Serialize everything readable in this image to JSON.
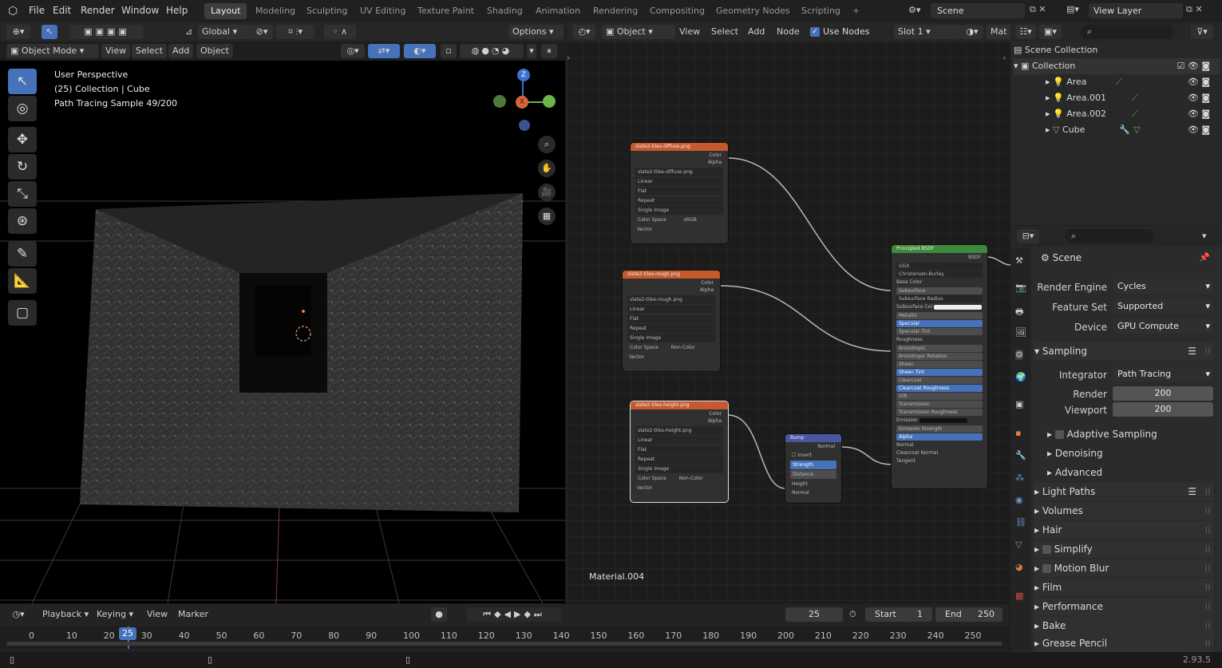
{
  "topbar": {
    "menus": [
      "File",
      "Edit",
      "Render",
      "Window",
      "Help"
    ],
    "workspaces": [
      "Layout",
      "Modeling",
      "Sculpting",
      "UV Editing",
      "Texture Paint",
      "Shading",
      "Animation",
      "Rendering",
      "Compositing",
      "Geometry Nodes",
      "Scripting"
    ],
    "active_workspace": "Layout",
    "scene": "Scene",
    "view_layer": "View Layer"
  },
  "viewport_header": {
    "transform": "Global",
    "options": "Options",
    "mode": "Object Mode",
    "menus": [
      "View",
      "Select",
      "Add",
      "Object"
    ]
  },
  "viewport_overlay": {
    "line1": "User Perspective",
    "line2": "(25) Collection | Cube",
    "line3": "Path Tracing Sample 49/200"
  },
  "gizmo": {
    "z": "Z",
    "x": "X"
  },
  "node_editor": {
    "object": "Object",
    "menus": [
      "View",
      "Select",
      "Add",
      "Node"
    ],
    "use_nodes": "Use Nodes",
    "slot": "Slot 1",
    "mat_partial": "Mat",
    "material_label": "Material.004",
    "nodes": {
      "img1_title": "slate2-tiles-diffuse.png",
      "img2_title": "slate2-tiles-rough.png",
      "img3_title": "slate2-tiles-height.png",
      "bump_title": "Bump",
      "bsdf_title": "Principled BSDF",
      "color": "Color",
      "alpha": "Alpha",
      "linear": "Linear",
      "flat": "Flat",
      "repeat": "Repeat",
      "single_image": "Single Image",
      "color_space": "Color Space",
      "srgb": "sRGB",
      "non_color": "Non-Color",
      "vector": "Vector",
      "bsdf_out": "BSDF",
      "ggx": "GGX",
      "christensen": "Christensen-Burley",
      "base_color": "Base Color",
      "subsurface": "Subsurface",
      "subsurface_radius": "Subsurface Radius",
      "subsurface_col": "Subsurface Col",
      "metallic": "Metallic",
      "specular": "Specular",
      "specular_tint": "Specular Tint",
      "roughness": "Roughness",
      "anisotropic": "Anisotropic",
      "anisotropic_rotation": "Anisotropic Rotation",
      "sheen": "Sheen",
      "sheen_tint": "Sheen Tint",
      "clearcoat": "Clearcoat",
      "clearcoat_roughness": "Clearcoat Roughness",
      "ior": "IOR",
      "transmission": "Transmission",
      "transmission_roughness": "Transmission Roughness",
      "emission": "Emission",
      "emission_strength": "Emission Strength",
      "alpha_in": "Alpha",
      "normal": "Normal",
      "clearcoat_normal": "Clearcoat Normal",
      "tangent": "Tangent",
      "invert": "Invert",
      "strength": "Strength",
      "distance": "Distance",
      "height": "Height"
    }
  },
  "outliner": {
    "scene_collection": "Scene Collection",
    "collection": "Collection",
    "items": [
      "Area",
      "Area.001",
      "Area.002",
      "Cube"
    ]
  },
  "properties": {
    "scene": "Scene",
    "render_engine_label": "Render Engine",
    "render_engine": "Cycles",
    "feature_set_label": "Feature Set",
    "feature_set": "Supported",
    "device_label": "Device",
    "device": "GPU Compute",
    "sampling": "Sampling",
    "integrator_label": "Integrator",
    "integrator": "Path Tracing",
    "render_label": "Render",
    "render_samples": "200",
    "viewport_label": "Viewport",
    "viewport_samples": "200",
    "adaptive": "Adaptive Sampling",
    "denoising": "Denoising",
    "advanced": "Advanced",
    "sections": [
      "Light Paths",
      "Volumes",
      "Hair",
      "Simplify",
      "Motion Blur",
      "Film",
      "Performance",
      "Bake",
      "Grease Pencil"
    ]
  },
  "timeline": {
    "playback": "Playback",
    "keying": "Keying",
    "view": "View",
    "marker": "Marker",
    "current_frame": "25",
    "start_label": "Start",
    "start": "1",
    "end_label": "End",
    "end": "250",
    "ticks": [
      "0",
      "10",
      "20",
      "25",
      "30",
      "40",
      "50",
      "60",
      "70",
      "80",
      "90",
      "100",
      "110",
      "120",
      "130",
      "140",
      "150",
      "160",
      "170",
      "180",
      "190",
      "200",
      "210",
      "220",
      "230",
      "240",
      "250"
    ]
  },
  "status": {
    "version": "2.93.5"
  },
  "colors": {
    "accent": "#4772b3",
    "image_node": "#c65a2e",
    "bsdf_node": "#3d8a3a",
    "vector_node": "#4a56a0"
  }
}
